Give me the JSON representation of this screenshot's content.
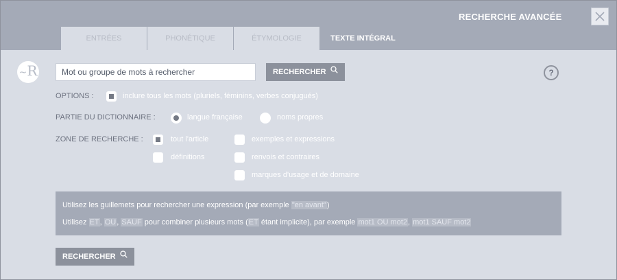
{
  "header": {
    "title": "RECHERCHE AVANCÉE",
    "close_icon": "close-icon",
    "tabs": [
      {
        "label": "ENTRÉES",
        "active": false
      },
      {
        "label": "PHONÉTIQUE",
        "active": false
      },
      {
        "label": "ÉTYMOLOGIE",
        "active": false
      },
      {
        "label": "TEXTE INTÉGRAL",
        "active": true
      }
    ]
  },
  "logo": {
    "letter": "R",
    "prefix": "~"
  },
  "search": {
    "placeholder": "Mot ou groupe de mots à rechercher",
    "value": "",
    "button_label": "RECHERCHER",
    "button_icon": "search-icon"
  },
  "help": {
    "label": "?"
  },
  "options": {
    "label": "OPTIONS :",
    "items": [
      {
        "label": "inclure tous les mots (pluriels, féminins, verbes conjugués)",
        "checked": true
      }
    ]
  },
  "partie": {
    "label": "PARTIE DU DICTIONNAIRE :",
    "items": [
      {
        "label": "langue française",
        "selected": true
      },
      {
        "label": "noms propres",
        "selected": false
      }
    ]
  },
  "zone": {
    "label": "ZONE DE RECHERCHE :",
    "items": [
      {
        "label": "tout l'article",
        "checked": true
      },
      {
        "label": "définitions",
        "checked": false
      },
      {
        "label": "exemples et expressions",
        "checked": false
      },
      {
        "label": "renvois et contraires",
        "checked": false
      },
      {
        "label": "marques d'usage et de domaine",
        "checked": false
      }
    ]
  },
  "info": {
    "line1": {
      "before": "Utilisez les guillemets pour rechercher une expression (par exemple ",
      "example": "\"en avant\"",
      "after": ")"
    },
    "line2": {
      "t1": "Utilisez ",
      "op1": "ET",
      "t2": ", ",
      "op2": "OU",
      "t3": ", ",
      "op3": "SAUF",
      "t4": " pour combiner plusieurs mots (",
      "op4": "ET",
      "t5": " étant implicite), par exemple ",
      "ex1": "mot1 OU mot2",
      "t6": ", ",
      "ex2": "mot1 SAUF mot2"
    }
  },
  "bottom_button": {
    "label": "RECHERCHER",
    "icon": "search-icon"
  },
  "colors": {
    "header_bg": "#a4aab7",
    "panel_bg": "#d9dde5",
    "button_bg": "#8c919c",
    "label_text": "#6d7280",
    "option_text": "#ffffff"
  }
}
